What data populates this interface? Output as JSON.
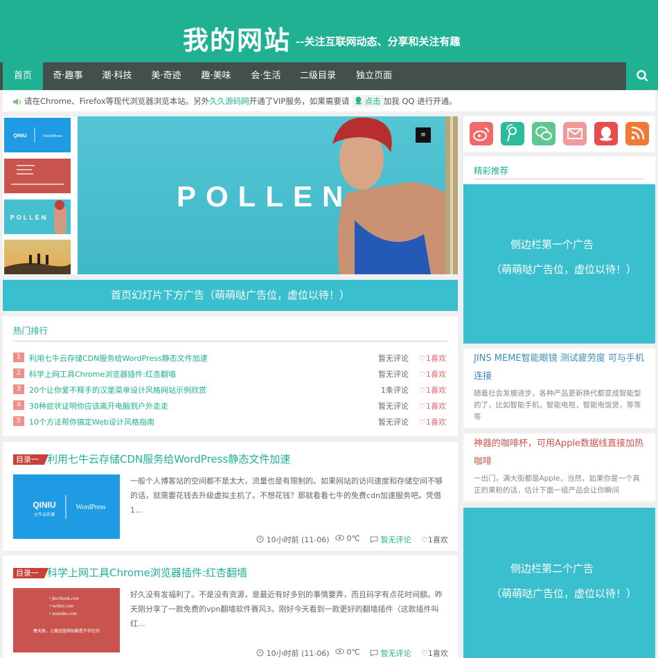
{
  "header": {
    "title": "我的网站",
    "tagline": "--关注互联网动态、分享和关注有趣"
  },
  "nav": {
    "items": [
      "首页",
      "奇·趣事",
      "潮·科技",
      "美·奇迹",
      "趣·美味",
      "会·生活",
      "二级目录",
      "独立页面"
    ],
    "active_index": 0,
    "search_icon": "search-icon"
  },
  "notice": {
    "text1": "请在Chrome、Firefox等现代浏览器浏览本站。另外",
    "link": "久久源码网",
    "text2": "开通了VIP服务，如果需要请",
    "button": "点击",
    "text3": "加我 QQ 进行开通。"
  },
  "slider": {
    "slide_text": "POLLEN",
    "thumb_pollen_text": "POLLEN",
    "thumb_qiniu_text": "QINIU",
    "thumb_wp_text": "WordPress",
    "menu_icon": "menu-icon"
  },
  "ad_below_slider": "首页幻灯片下方广告（萌萌哒广告位，虚位以待！）",
  "hot": {
    "title": "热门排行",
    "items": [
      {
        "rank": "1",
        "title": "利用七牛云存储CDN服务给WordPress静态文件加速",
        "comments": "暂无评论",
        "likes": "1喜欢"
      },
      {
        "rank": "2",
        "title": "科学上网工具Chrome浏览器插件:红杏翻墙",
        "comments": "暂无评论",
        "likes": "1喜欢"
      },
      {
        "rank": "3",
        "title": "20个让你爱不释手的汉堡菜单设计风格网站示例欣赏",
        "comments": "1条评论",
        "likes": "1喜欢"
      },
      {
        "rank": "4",
        "title": "30种症状证明你应该离开电脑到户外走走",
        "comments": "暂无评论",
        "likes": "1喜欢"
      },
      {
        "rank": "5",
        "title": "10个方法帮你搞定Web设计风格指南",
        "comments": "暂无评论",
        "likes": "1喜欢"
      }
    ]
  },
  "posts": [
    {
      "tag": "目录一",
      "title": "利用七牛云存储CDN服务给WordPress静态文件加速",
      "excerpt": "一般个人博客站的空间都不是太大，流量也是有限制的。如果网站的访问速度和存储空间不够的话，就需要花钱去升级虚拟主机了。不想花钱？那就看看七牛的免费cdn加速服务吧。凭借 1...",
      "img_qiniu": "QINIU",
      "img_qiniu_sub": "七牛云存储",
      "img_wp": "WordPress",
      "time": "10小时前 (11-06)",
      "views": "0℃",
      "comments": "暂无评论",
      "likes": "1喜欢"
    },
    {
      "tag": "目录一",
      "title": "科学上网工具Chrome浏览器插件:红杏翻墙",
      "excerpt": "好久没有发福利了。不是没有资源，是最近有好多别的事情要弄，而且码字有点花时间额。昨天刚分享了一款免费的vpn翻墙软件赛风3。刚好今天看到一款更好的翻墙插件（这款插件叫红...",
      "img_lines": [
        "• facebook.com",
        "• twitter.com",
        "• youtube.com"
      ],
      "img_caption": "春天般，上面这些网站都是不存在的",
      "time": "10小时前 (11-06)",
      "views": "0℃",
      "comments": "暂无评论",
      "likes": "1喜欢"
    }
  ],
  "sidebar": {
    "social_icons": [
      "weibo-icon",
      "tencent-weibo-icon",
      "wechat-icon",
      "email-icon",
      "qq-icon",
      "rss-icon"
    ],
    "social_colors": [
      "#ef6b6b",
      "#2dbc9b",
      "#5fc890",
      "#f29a9a",
      "#e84d4d",
      "#f27836"
    ],
    "picks_title": "精彩推荐",
    "ad1_line1": "侧边栏第一个广告",
    "ad1_line2": "（萌萌哒广告位，虚位以待！）",
    "post1_title": "JINS MEME智能眼镜 测试疲劳度 可与手机连接",
    "post1_excerpt": "随着社会发展进步，各种产品更新换代都变成智能型的了，比如智能手机，智能电视，智能电饭煲，等等等",
    "post2_title": "神器的咖啡杯，可用Apple数据线直接加热咖啡",
    "post2_excerpt": "一出门，满大街都是Apple，当然，如果你是一个真正的果粉的话，估计下面一组产品会让你瞬间",
    "ad2_line1": "侧边栏第二个广告",
    "ad2_line2": "（萌萌哒广告位，虚位以待！）"
  }
}
